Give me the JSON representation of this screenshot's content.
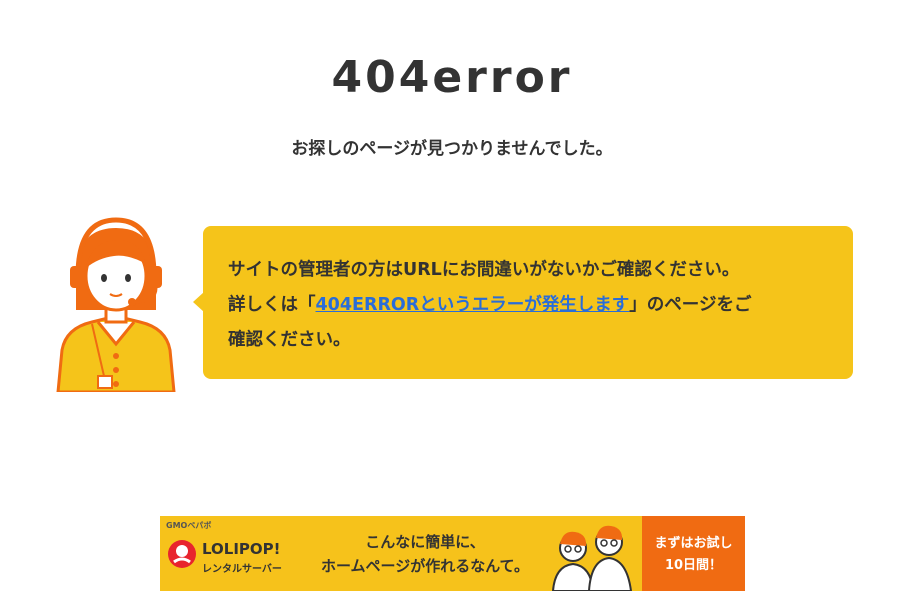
{
  "header": {
    "title": "404error",
    "subtitle": "お探しのページが見つかりませんでした。"
  },
  "message": {
    "line1": "サイトの管理者の方はURLにお間違いがないかご確認ください。",
    "line2_prefix": "詳しくは「",
    "link_text": "404ERRORというエラーが発生します",
    "line2_suffix": "」のページをご",
    "line3": "確認ください。"
  },
  "illustration": {
    "icon": "support-operator-icon"
  },
  "banner": {
    "company": "GMOペパボ",
    "brand": "LOLIPOP!",
    "brand_sub": "レンタルサーバー",
    "copy_line1": "こんなに簡単に、",
    "copy_line2": "ホームページが作れるなんて。",
    "cta_line1": "まずはお試し",
    "cta_line2": "10日間！"
  },
  "colors": {
    "bubble": "#f5c41a",
    "link": "#2a6dd8",
    "banner_bg": "#f6c21b",
    "cta_bg": "#f06b12",
    "operator_accent": "#f06b12"
  }
}
